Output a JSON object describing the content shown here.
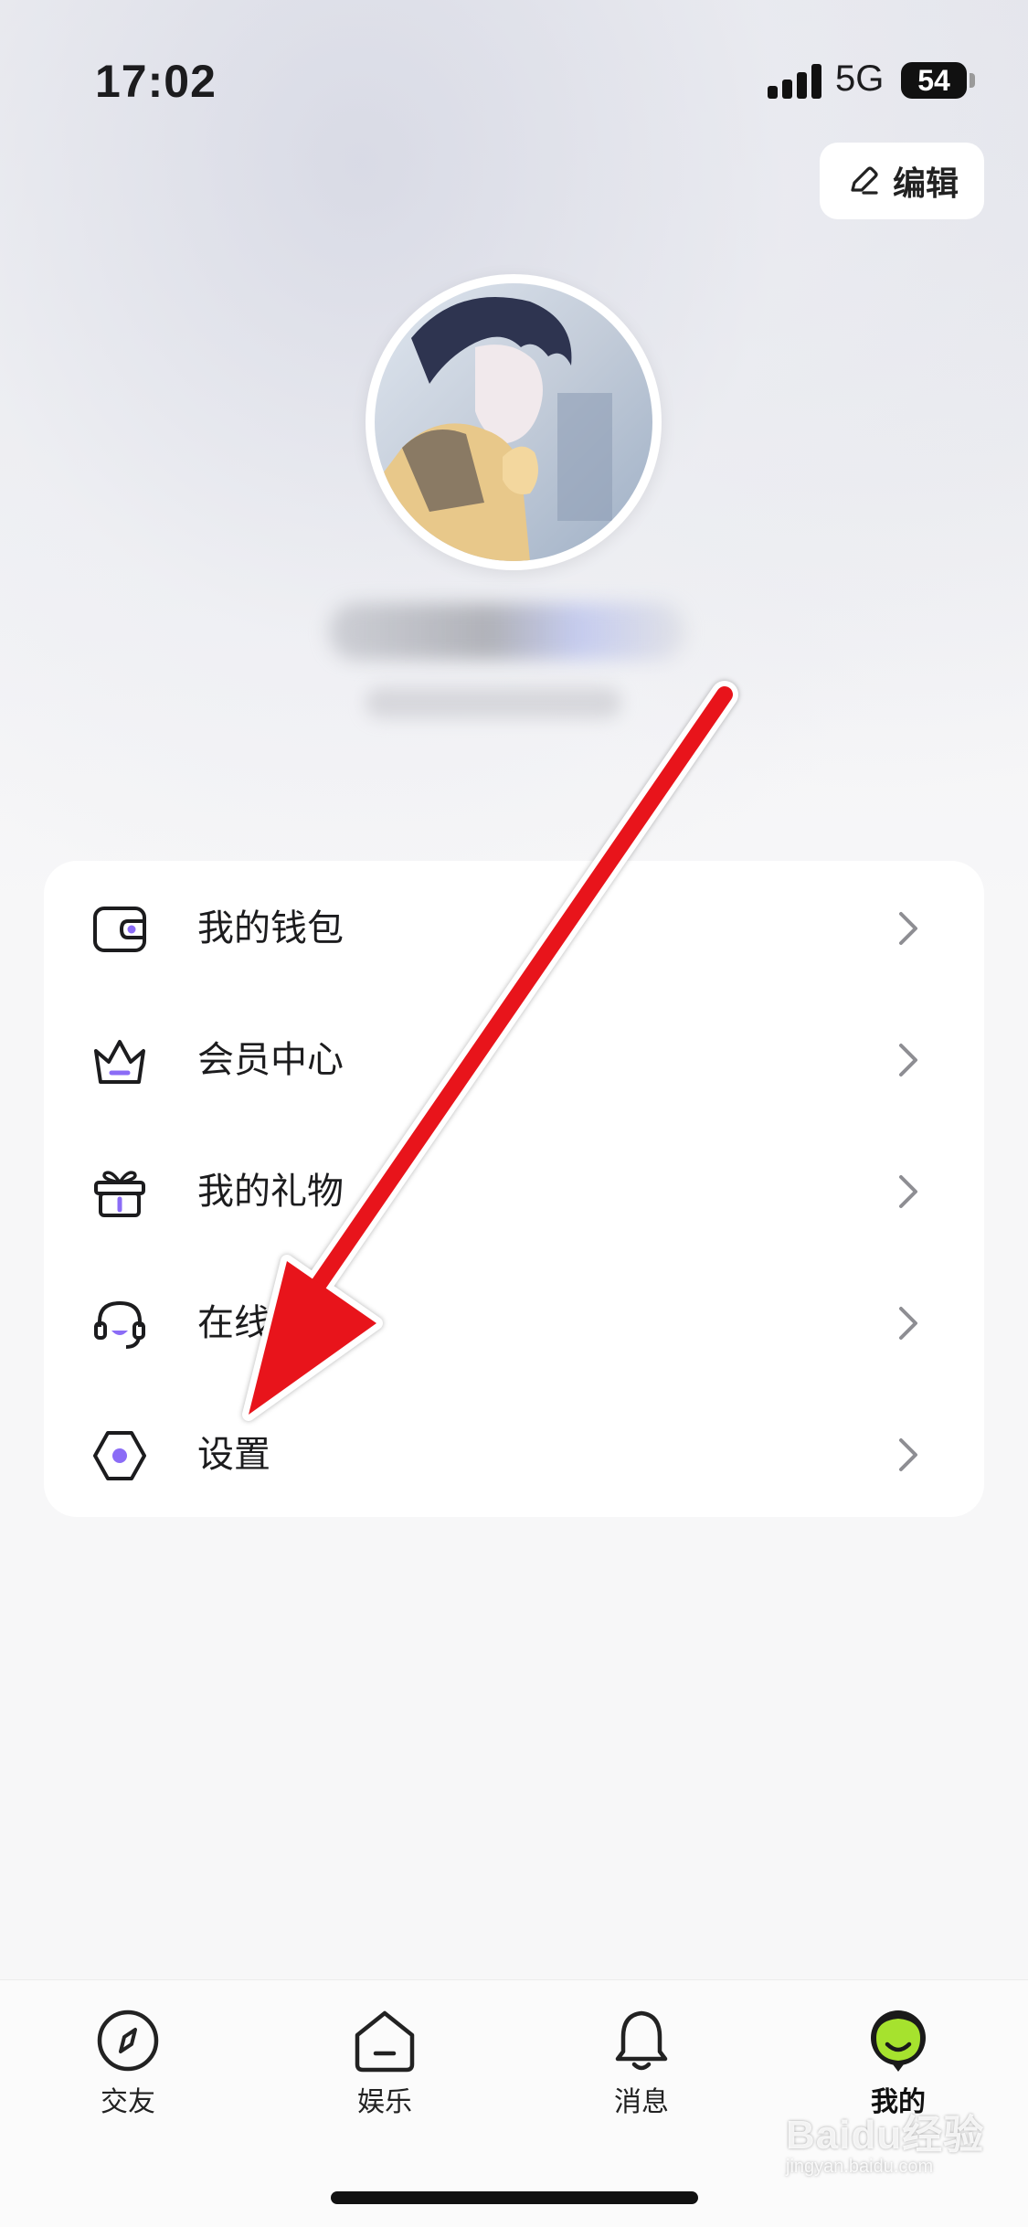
{
  "status_bar": {
    "time": "17:02",
    "network": "5G",
    "battery": "54"
  },
  "header": {
    "edit_label": "编辑"
  },
  "menu": {
    "items": [
      {
        "label": "我的钱包",
        "icon": "wallet-icon"
      },
      {
        "label": "会员中心",
        "icon": "crown-icon"
      },
      {
        "label": "我的礼物",
        "icon": "gift-icon"
      },
      {
        "label": "在线客服",
        "icon": "headset-icon"
      },
      {
        "label": "设置",
        "icon": "settings-icon"
      }
    ]
  },
  "tabbar": {
    "tabs": [
      {
        "label": "交友",
        "icon": "compass-icon",
        "active": false
      },
      {
        "label": "娱乐",
        "icon": "home-icon",
        "active": false
      },
      {
        "label": "消息",
        "icon": "bell-icon",
        "active": false
      },
      {
        "label": "我的",
        "icon": "profile-face-icon",
        "active": true
      }
    ]
  },
  "watermark": {
    "brand": "Baidu经验",
    "url": "jingyan.baidu.com"
  },
  "colors": {
    "accent": "#8b6cf6",
    "active_tab": "#a6e22e",
    "annotation_arrow": "#e8141b"
  }
}
